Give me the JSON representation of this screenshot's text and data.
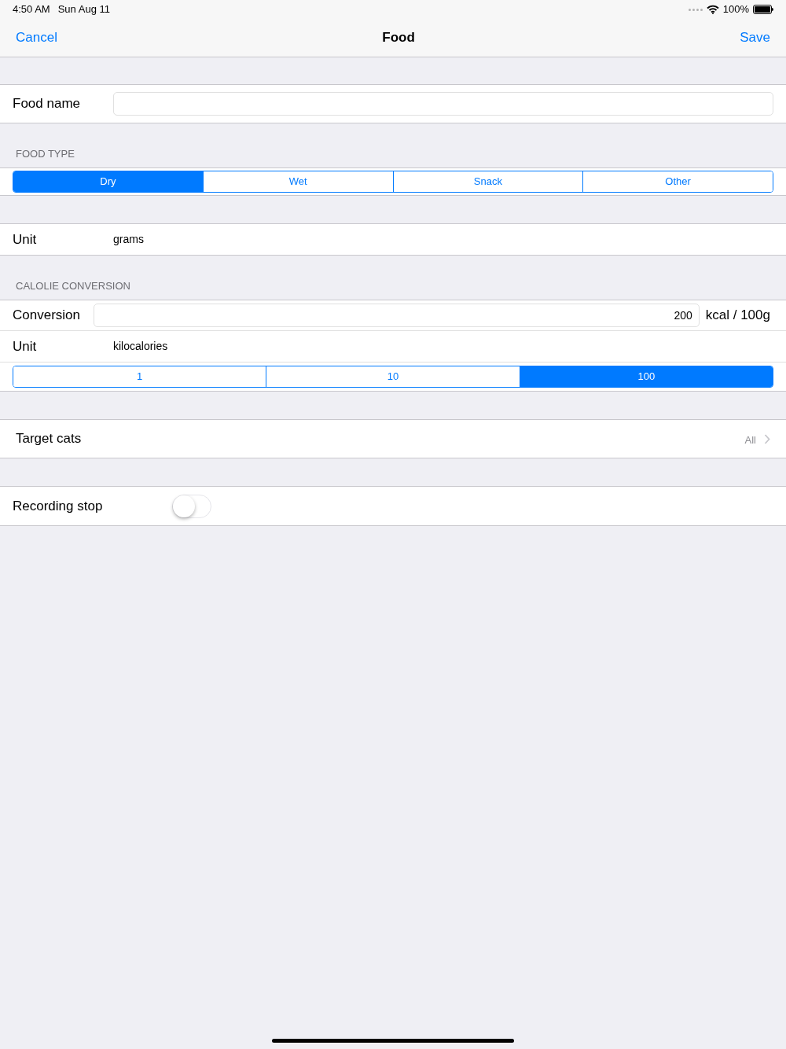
{
  "status_bar": {
    "time": "4:50 AM",
    "date": "Sun Aug 11",
    "battery": "100%"
  },
  "nav": {
    "cancel": "Cancel",
    "title": "Food",
    "save": "Save"
  },
  "food_name": {
    "label": "Food name"
  },
  "food_type": {
    "header": "FOOD TYPE",
    "segments": [
      {
        "label": "Dry",
        "selected": true
      },
      {
        "label": "Wet",
        "selected": false
      },
      {
        "label": "Snack",
        "selected": false
      },
      {
        "label": "Other",
        "selected": false
      }
    ]
  },
  "unit": {
    "label": "Unit",
    "value": "grams"
  },
  "calorie_conversion": {
    "header": "CALOLIE CONVERSION",
    "conversion_label": "Conversion",
    "conversion_value": "200",
    "conversion_suffix": "kcal / 100g",
    "unit_label": "Unit",
    "unit_value": "kilocalories",
    "segments": [
      {
        "label": "1",
        "selected": false
      },
      {
        "label": "10",
        "selected": false
      },
      {
        "label": "100",
        "selected": true
      }
    ]
  },
  "target_cats": {
    "label": "Target cats",
    "value": "All"
  },
  "recording_stop": {
    "label": "Recording stop",
    "on": false
  }
}
